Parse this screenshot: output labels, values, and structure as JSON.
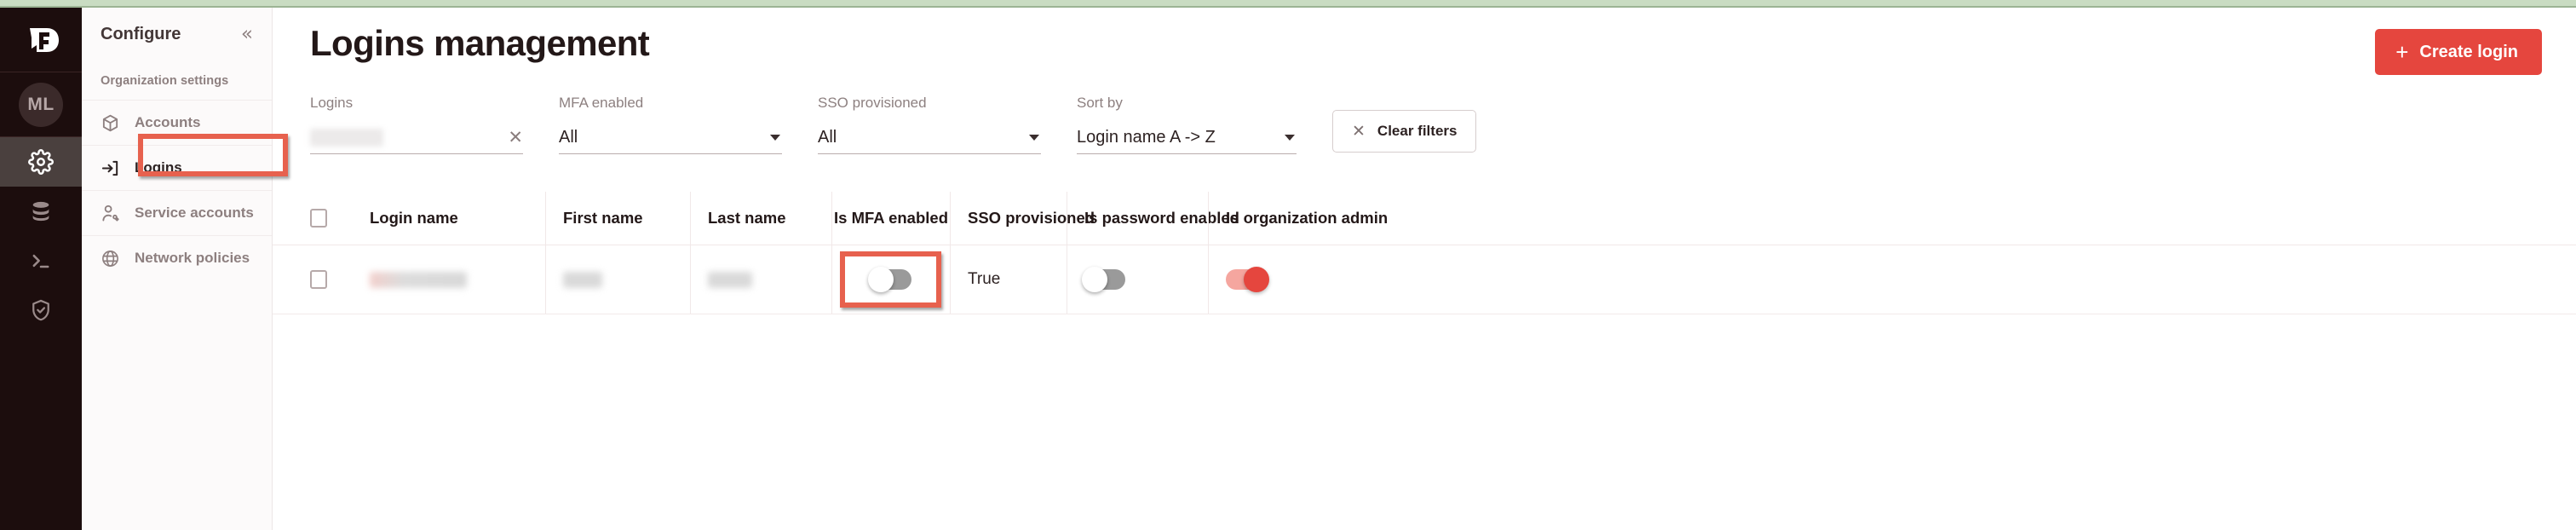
{
  "rail": {
    "logo": "feature-flag-logo",
    "avatar_initials": "ML",
    "items": [
      {
        "icon": "gear-icon",
        "name": "configure",
        "active": true
      },
      {
        "icon": "database-icon",
        "name": "data",
        "active": false
      },
      {
        "icon": "terminal-icon",
        "name": "terminal",
        "active": false
      },
      {
        "icon": "shield-check-icon",
        "name": "security",
        "active": false
      }
    ]
  },
  "sidebar": {
    "title": "Configure",
    "collapse_icon": "«",
    "section_label": "Organization settings",
    "items": [
      {
        "label": "Accounts",
        "icon": "box-icon",
        "current": false
      },
      {
        "label": "Logins",
        "icon": "login-arrow-icon",
        "current": true
      },
      {
        "label": "Service accounts",
        "icon": "person-wrench-icon",
        "current": false
      },
      {
        "label": "Network policies",
        "icon": "globe-icon",
        "current": false
      }
    ]
  },
  "header": {
    "page_title": "Logins management",
    "create_button": {
      "label": "Create login",
      "plus": "+",
      "color": "#e5463e"
    }
  },
  "filters": {
    "logins": {
      "label": "Logins",
      "value": "",
      "redacted": true,
      "clear_icon": "✕"
    },
    "mfa_enabled": {
      "label": "MFA enabled",
      "value": "All"
    },
    "sso_provisioned": {
      "label": "SSO provisioned",
      "value": "All"
    },
    "sort_by": {
      "label": "Sort by",
      "value": "Login name A -> Z"
    },
    "clear_filters": {
      "label": "Clear filters",
      "icon": "✕"
    }
  },
  "table": {
    "columns": [
      "Login name",
      "First name",
      "Last name",
      "Is MFA enabled",
      "SSO provisioned",
      "Is password enabled",
      "Is organization admin"
    ],
    "rows": [
      {
        "login_name": "",
        "first_name": "",
        "last_name": "",
        "is_mfa_enabled": false,
        "sso_provisioned": "True",
        "is_password_enabled": false,
        "is_organization_admin": true,
        "redacted": true
      }
    ]
  },
  "annotations": {
    "highlight_color": "#e7614e",
    "boxes": [
      "logins-sidebar-item",
      "is-mfa-enabled-toggle"
    ]
  }
}
